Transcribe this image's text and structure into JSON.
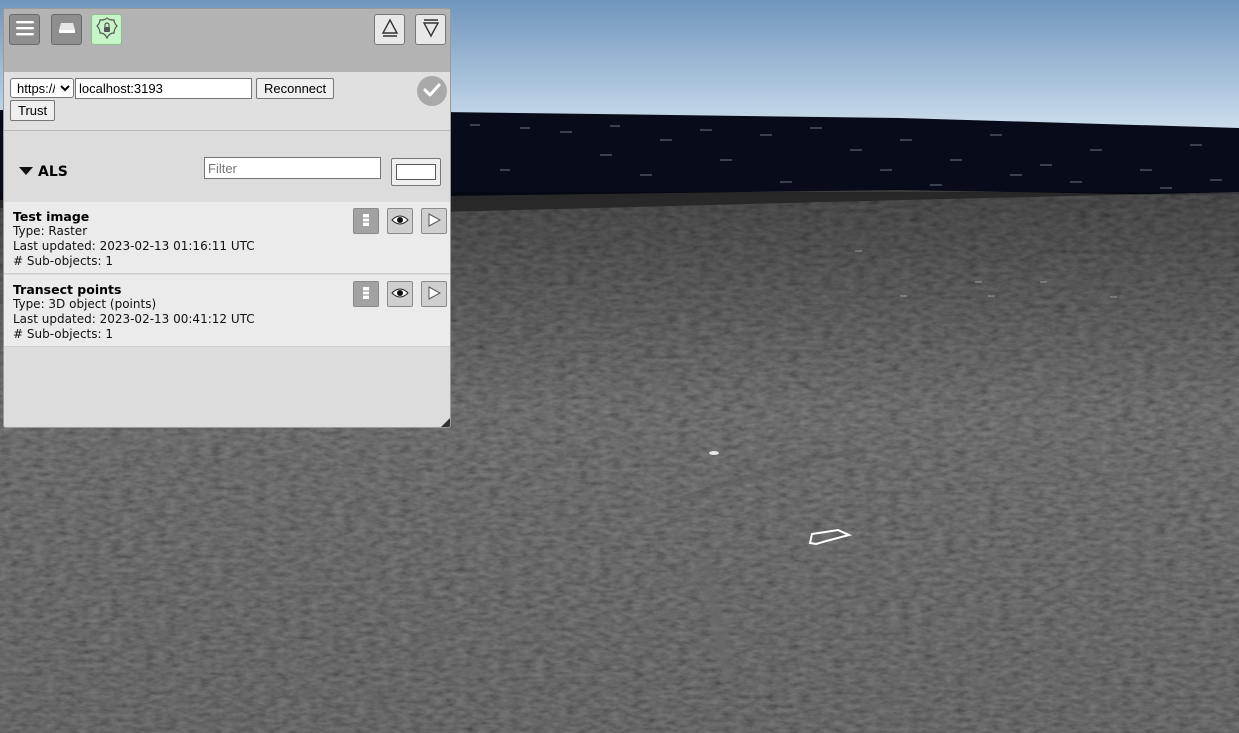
{
  "toolbar": {
    "menu_icon": "hamburger-menu-icon",
    "layers_icon": "layers-icon",
    "lock_icon": "security-lock-icon",
    "collapse_up_icon": "triangle-up-icon",
    "collapse_down_icon": "triangle-down-icon"
  },
  "connection": {
    "protocol_value": "https://",
    "host_value": "localhost:3193",
    "reconnect_label": "Reconnect",
    "trust_label": "Trust",
    "status_icon": "checkmark-icon"
  },
  "group": {
    "title": "ALS",
    "toggle_icon": "triangle-down-icon",
    "filter_placeholder": "Filter",
    "color_value": "#ffffff"
  },
  "objects": [
    {
      "name": "Test image",
      "type": "Type: Raster",
      "updated": "Last updated: 2023-02-13 01:16:11 UTC",
      "subobjects": "# Sub-objects: 1"
    },
    {
      "name": "Transect points",
      "type": "Type: 3D object (points)",
      "updated": "Last updated: 2023-02-13 00:41:12 UTC",
      "subobjects": "# Sub-objects: 1"
    }
  ],
  "colors": {
    "sky_top": "#6f95bd",
    "sky_bottom": "#cfe0ee",
    "wall": "#070b1a",
    "terrain": "#3b3b3b",
    "toolbar_bg": "#b3b3b3",
    "lock_button_bg": "#c6f5c8"
  }
}
